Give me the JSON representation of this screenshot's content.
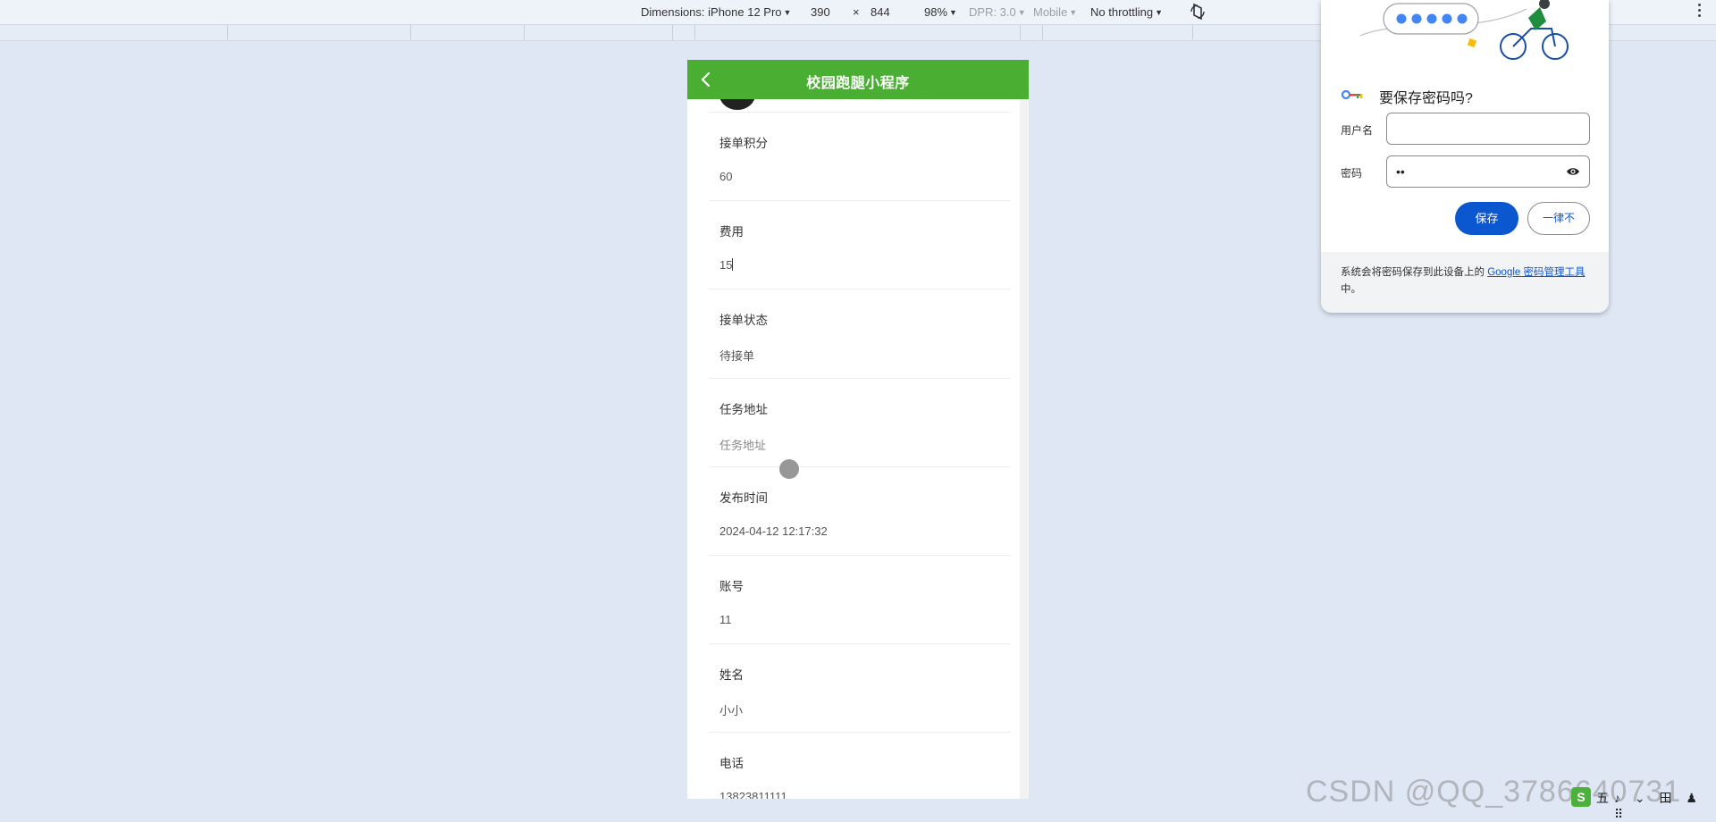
{
  "devtools": {
    "dimensions_label": "Dimensions: iPhone 12 Pro",
    "width": "390",
    "times": "×",
    "height": "844",
    "zoom": "98%",
    "dpr": "DPR: 3.0",
    "mobile": "Mobile",
    "throttling": "No throttling"
  },
  "app": {
    "title": "校园跑腿小程序",
    "fields": [
      {
        "label": "接单积分",
        "value": "60"
      },
      {
        "label": "费用",
        "value": "15"
      },
      {
        "label": "接单状态",
        "value": "待接单"
      },
      {
        "label": "任务地址",
        "value": "任务地址"
      },
      {
        "label": "发布时间",
        "value": "2024-04-12 12:17:32"
      },
      {
        "label": "账号",
        "value": "11"
      },
      {
        "label": "姓名",
        "value": "小小"
      },
      {
        "label": "电话",
        "value": "13823811111"
      }
    ]
  },
  "password_prompt": {
    "title": "要保存密码吗?",
    "username_label": "用户名",
    "username_value": "",
    "password_label": "密码",
    "password_value": "••",
    "save_label": "保存",
    "never_label": "一律不",
    "footer_text_before": "系统会将密码保存到此设备上的 ",
    "footer_link": "Google 密码管理工具",
    "footer_text_after": "中。"
  },
  "watermark": "CSDN @QQ_3786640731",
  "tray": {
    "ime_logo": "S",
    "ime_mode": "五",
    "items": "♪ ⌄ 田 ♟ ⠿"
  },
  "colors": {
    "nav_green": "#4aae32",
    "save_blue": "#0b57d0",
    "page_bg": "#dfe7f4"
  }
}
